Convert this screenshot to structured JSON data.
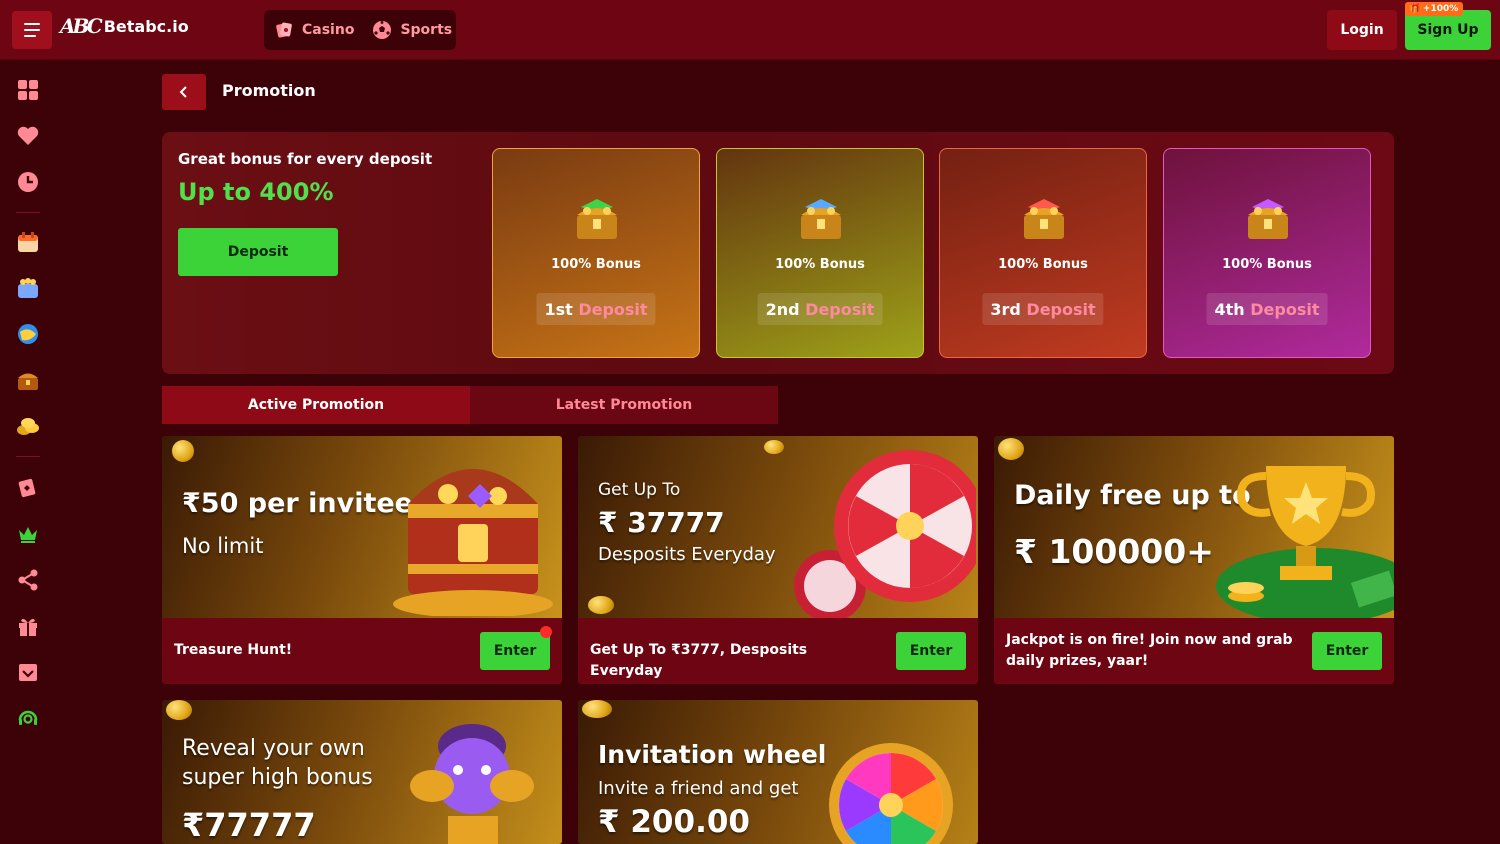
{
  "topbar": {
    "brand": "Betabc.io",
    "logo_mark": "ABC",
    "nav": [
      {
        "label": "Casino",
        "icon": "cards-icon"
      },
      {
        "label": "Sports",
        "icon": "soccer-ball-icon"
      }
    ],
    "login_label": "Login",
    "signup_label": "Sign Up",
    "signup_badge": "+100%"
  },
  "sidebar": {
    "items": [
      "grid-icon",
      "heart-icon",
      "clock-icon",
      "calendar-promo-icon",
      "tournament-icon",
      "globe-game-icon",
      "treasure-chest-icon",
      "gold-coins-icon",
      "cards-icon",
      "crown-icon",
      "share-icon",
      "gift-icon",
      "inbox-icon",
      "support-icon"
    ]
  },
  "page": {
    "title": "Promotion"
  },
  "bonus": {
    "headline": "Great bonus for every deposit",
    "up_to": "Up to 400%",
    "deposit_label": "Deposit",
    "cards": [
      {
        "bonus": "100% Bonus",
        "ordinal": "1st",
        "word": "Deposit"
      },
      {
        "bonus": "100% Bonus",
        "ordinal": "2nd",
        "word": "Deposit"
      },
      {
        "bonus": "100% Bonus",
        "ordinal": "3rd",
        "word": "Deposit"
      },
      {
        "bonus": "100% Bonus",
        "ordinal": "4th",
        "word": "Deposit"
      }
    ]
  },
  "promo_tabs": {
    "active": "Active Promotion",
    "latest": "Latest Promotion"
  },
  "promos": [
    {
      "banner_l1": "₹50 per invitee",
      "banner_l2": "No limit",
      "footer": "Treasure Hunt!",
      "enter": "Enter"
    },
    {
      "banner_l1": "Get Up To",
      "banner_l2": "₹ 37777",
      "banner_l3": "Desposits Everyday",
      "footer": "Get Up To ₹3777, Desposits Everyday",
      "enter": "Enter"
    },
    {
      "banner_l1": "Daily free up to",
      "banner_l2": "₹ 100000+",
      "footer": "Jackpot is on fire! Join now and grab daily prizes, yaar!",
      "enter": "Enter"
    },
    {
      "banner_l1": "Reveal your own",
      "banner_l2": "super high bonus",
      "banner_l3": "₹77777"
    },
    {
      "banner_l1": "Invitation wheel",
      "banner_l2": "Invite a friend and get",
      "banner_l3": "₹ 200.00"
    }
  ],
  "colors": {
    "topbar": "#6e0512",
    "background": "#3d0207",
    "accent_green": "#3bd338",
    "accent_red": "#9d0e1b"
  }
}
